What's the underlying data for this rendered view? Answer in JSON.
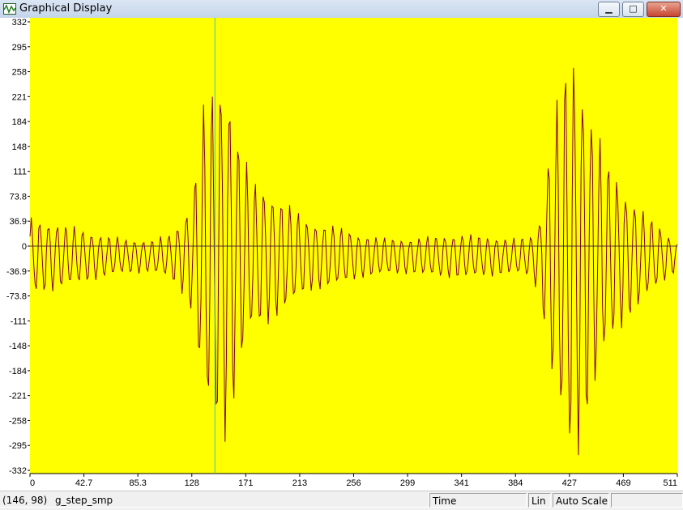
{
  "window": {
    "title": "Graphical Display",
    "minimize_label": "▁",
    "maximize_label": "□",
    "close_label": "✕"
  },
  "status": {
    "coords": "(146, 98)",
    "variable": "g_step_smp",
    "x_mode": "Time",
    "scale_type": "Lin",
    "scale_mode": "Auto Scale"
  },
  "colors": {
    "background": "#ffff00",
    "trace": "#800020",
    "cursor": "#40c0c0",
    "axis": "#000000"
  },
  "chart_data": {
    "type": "line",
    "xlim": [
      0,
      511
    ],
    "ylim": [
      -332,
      332
    ],
    "x_ticks": [
      "0",
      "42.7",
      "85.3",
      "128",
      "171",
      "213",
      "256",
      "299",
      "341",
      "384",
      "427",
      "469",
      "511"
    ],
    "y_ticks": [
      "332",
      "295",
      "258",
      "221",
      "184",
      "148",
      "111",
      "73.8",
      "36.9",
      "0",
      "-36.9",
      "-73.8",
      "-111",
      "-148",
      "-184",
      "-221",
      "-258",
      "-295",
      "-332"
    ],
    "cursor_x": 146,
    "period": 6.8,
    "envelope": [
      [
        0,
        52
      ],
      [
        15,
        48
      ],
      [
        35,
        40
      ],
      [
        55,
        30
      ],
      [
        75,
        24
      ],
      [
        95,
        22
      ],
      [
        110,
        30
      ],
      [
        120,
        50
      ],
      [
        128,
        80
      ],
      [
        133,
        150
      ],
      [
        138,
        215
      ],
      [
        146,
        235
      ],
      [
        152,
        255
      ],
      [
        158,
        235
      ],
      [
        165,
        160
      ],
      [
        175,
        105
      ],
      [
        190,
        90
      ],
      [
        205,
        70
      ],
      [
        220,
        48
      ],
      [
        240,
        42
      ],
      [
        260,
        30
      ],
      [
        280,
        25
      ],
      [
        300,
        24
      ],
      [
        320,
        28
      ],
      [
        340,
        30
      ],
      [
        360,
        28
      ],
      [
        380,
        24
      ],
      [
        395,
        28
      ],
      [
        403,
        55
      ],
      [
        410,
        150
      ],
      [
        418,
        230
      ],
      [
        427,
        285
      ],
      [
        432,
        275
      ],
      [
        440,
        220
      ],
      [
        455,
        130
      ],
      [
        470,
        90
      ],
      [
        485,
        60
      ],
      [
        500,
        35
      ],
      [
        511,
        20
      ]
    ],
    "offset": -15
  }
}
